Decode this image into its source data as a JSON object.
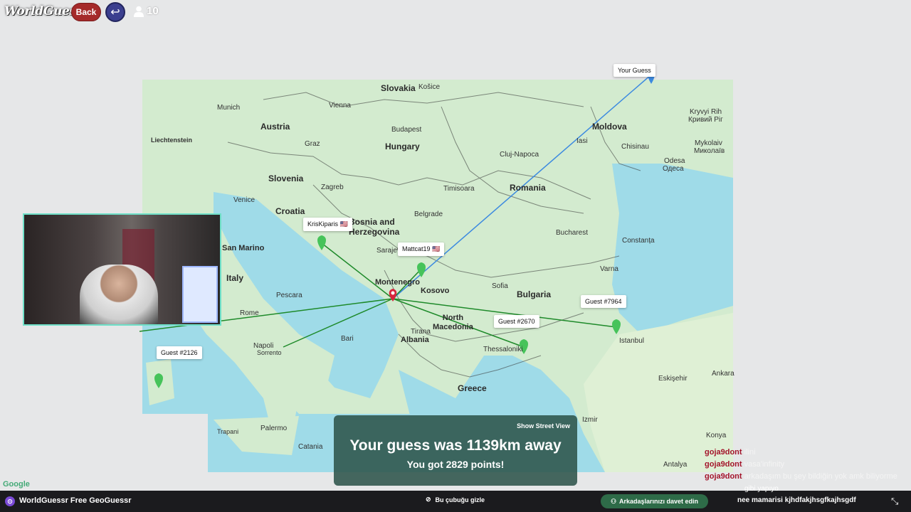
{
  "header": {
    "logo": "WorldGuessr",
    "back_label": "Back",
    "players_count": "10"
  },
  "map": {
    "countries": [
      {
        "label": "Slovakia"
      },
      {
        "label": "Austria"
      },
      {
        "label": "Hungary"
      },
      {
        "label": "Moldova"
      },
      {
        "label": "Slovenia"
      },
      {
        "label": "Croatia"
      },
      {
        "label": "Romania"
      },
      {
        "label": "Bosnia and\nHerzegovina"
      },
      {
        "label": "Italy"
      },
      {
        "label": "Montenegro"
      },
      {
        "label": "Kosovo"
      },
      {
        "label": "Bulgaria"
      },
      {
        "label": "North\nMacedonia"
      },
      {
        "label": "Albania"
      },
      {
        "label": "Greece"
      },
      {
        "label": "San Marino"
      }
    ],
    "places": [
      "Košice",
      "Munich",
      "Vienna",
      "Budapest",
      "Kryvyi Rih",
      "Кривий Ріг",
      "Liechtenstein",
      "Graz",
      "Cluj-Napoca",
      "Iasi",
      "Chisinau",
      "Mykolaiv",
      "Миколаїв",
      "Odesa",
      "Одеса",
      "Zagreb",
      "Timisoara",
      "Venice",
      "Belgrade",
      "Bucharest",
      "Sarajevo",
      "Constanța",
      "Varna",
      "Sofia",
      "Pescara",
      "Rome",
      "Tirana",
      "Istanbul",
      "Napoli",
      "Sorrento",
      "Bari",
      "Thessaloniki",
      "Ankara",
      "Eskişehir",
      "Palermo",
      "Catania",
      "Trapani",
      "Konya",
      "Antalya",
      "Izmir"
    ],
    "guess_tags": [
      "Your Guess",
      "KrisKiparis 🇺🇸",
      "Mattcat19 🇺🇸",
      "Guest #7964",
      "Guest #2670",
      "Guest #2126"
    ],
    "attribution": "Google"
  },
  "result": {
    "show_street_view": "Show Street View",
    "headline": "Your guess was 1139km away",
    "points": "You got 2829 points!"
  },
  "chat": [
    {
      "user": "goja9dont",
      "msg": "ilini"
    },
    {
      "user": "goja9dont",
      "msg": "vasa'infinity"
    },
    {
      "user": "goja9dont",
      "msg": "arkadaşım bu şey bildiğin yok amk biliyorme"
    }
  ],
  "chat_extra": {
    "line1": "gibi yapıyo",
    "line2": "nee mamarisi kjhdfakjhsgfkajhsgdf"
  },
  "bottombar": {
    "title": "WorldGuessr Free GeoGuessr",
    "hide_label": "Bu çubuğu gizle",
    "invite_label": "Arkadaşlarınızı davet edin"
  },
  "colors": {
    "sea": "#9fdbe8",
    "land": "#cfe9cf",
    "result_panel": "#2d544a",
    "pin_actual": "#d7263d",
    "pin_guess": "#46c35a",
    "line_user": "#3c8ae0",
    "line_other": "#1e8a2a"
  }
}
